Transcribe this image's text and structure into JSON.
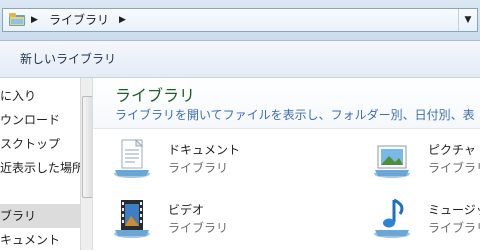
{
  "address": {
    "breadcrumb": "ライブラリ",
    "arrow": "▶",
    "dropdown": "▼"
  },
  "commandbar": {
    "new_library": "新しいライブラリ"
  },
  "navpane": {
    "items": [
      {
        "label": "に入り"
      },
      {
        "label": "ウンロード"
      },
      {
        "label": "スクトップ"
      },
      {
        "label": "近表示した場所"
      },
      {
        "label": "ブラリ"
      },
      {
        "label": "キュメント"
      }
    ]
  },
  "library": {
    "title": "ライブラリ",
    "description": "ライブラリを開いてファイルを表示し、フォルダー別、日付別、表",
    "items": [
      {
        "name": "ドキュメント",
        "type": "ライブラリ",
        "icon": "documents-library-icon"
      },
      {
        "name": "ピクチャ",
        "type": "ライブラリ",
        "icon": "pictures-library-icon"
      },
      {
        "name": "ビデオ",
        "type": "ライブラリ",
        "icon": "videos-library-icon"
      },
      {
        "name": "ミュージック",
        "type": "ライブラリ",
        "icon": "music-library-icon"
      }
    ]
  }
}
